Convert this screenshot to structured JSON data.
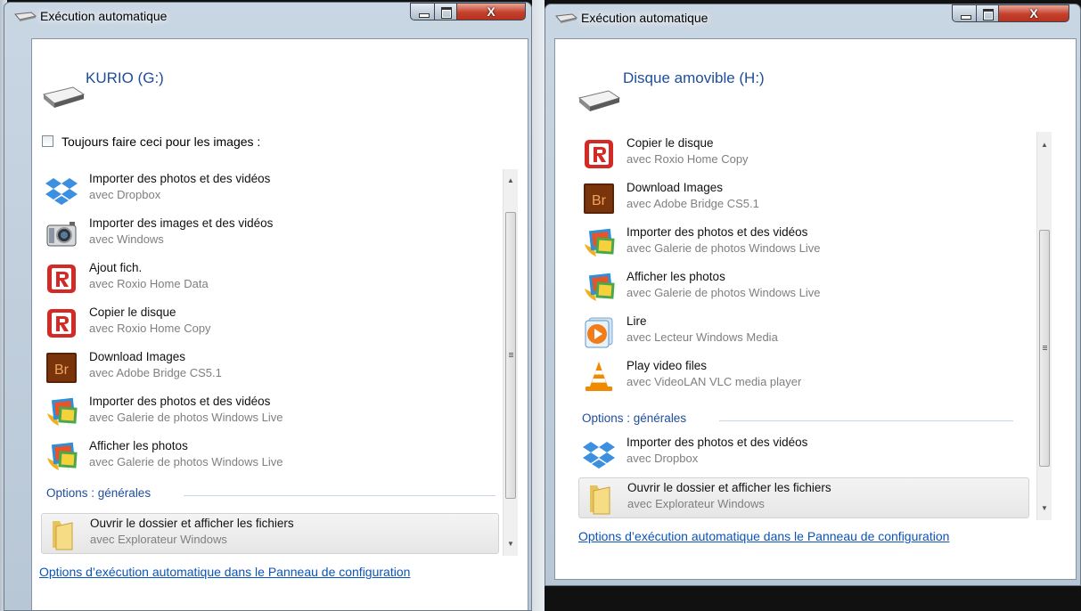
{
  "window1": {
    "title": "Exécution automatique",
    "drive_name": "KURIO (G:)",
    "checkbox_label": "Toujours faire ceci pour les images :",
    "items": [
      {
        "title": "Importer des photos et des vidéos",
        "sub": "avec Dropbox",
        "icon": "dropbox-icon"
      },
      {
        "title": "Importer des images et des vidéos",
        "sub": "avec Windows",
        "icon": "camera-icon"
      },
      {
        "title": "Ajout fich.",
        "sub": "avec Roxio Home Data",
        "icon": "roxio-icon"
      },
      {
        "title": "Copier le disque",
        "sub": "avec Roxio Home Copy",
        "icon": "roxio-icon"
      },
      {
        "title": "Download Images",
        "sub": "avec Adobe Bridge CS5.1",
        "icon": "adobe-bridge-icon"
      },
      {
        "title": "Importer des photos et des vidéos",
        "sub": "avec Galerie de photos Windows Live",
        "icon": "photo-gallery-icon"
      },
      {
        "title": "Afficher les photos",
        "sub": "avec Galerie de photos Windows Live",
        "icon": "photo-gallery-icon"
      }
    ],
    "section_label": "Options : générales",
    "general_items": [
      {
        "title": "Ouvrir le dossier et afficher les fichiers",
        "sub": "avec Explorateur Windows",
        "icon": "folder-icon"
      }
    ],
    "control_panel_link": "Options d’exécution automatique dans le Panneau de configuration"
  },
  "window2": {
    "title": "Exécution automatique",
    "drive_name": "Disque amovible (H:)",
    "items": [
      {
        "title": "Copier le disque",
        "sub": "avec Roxio Home Copy",
        "icon": "roxio-icon"
      },
      {
        "title": "Download Images",
        "sub": "avec Adobe Bridge CS5.1",
        "icon": "adobe-bridge-icon"
      },
      {
        "title": "Importer des photos et des vidéos",
        "sub": "avec Galerie de photos Windows Live",
        "icon": "photo-gallery-icon"
      },
      {
        "title": "Afficher les photos",
        "sub": "avec Galerie de photos Windows Live",
        "icon": "photo-gallery-icon"
      },
      {
        "title": "Lire",
        "sub": "avec Lecteur Windows Media",
        "icon": "media-player-icon"
      },
      {
        "title": "Play video files",
        "sub": "avec VideoLAN VLC media player",
        "icon": "vlc-icon"
      }
    ],
    "section_label": "Options : générales",
    "general_items": [
      {
        "title": "Importer des photos et des vidéos",
        "sub": "avec Dropbox",
        "icon": "dropbox-icon"
      },
      {
        "title": "Ouvrir le dossier et afficher les fichiers",
        "sub": "avec Explorateur Windows",
        "icon": "folder-icon"
      }
    ],
    "control_panel_link": "Options d’exécution automatique dans le Panneau de configuration"
  },
  "window_controls": {
    "close_glyph": "X"
  },
  "scrollbar_glyphs": {
    "up": "▲",
    "down": "▼",
    "grip": "≡"
  }
}
